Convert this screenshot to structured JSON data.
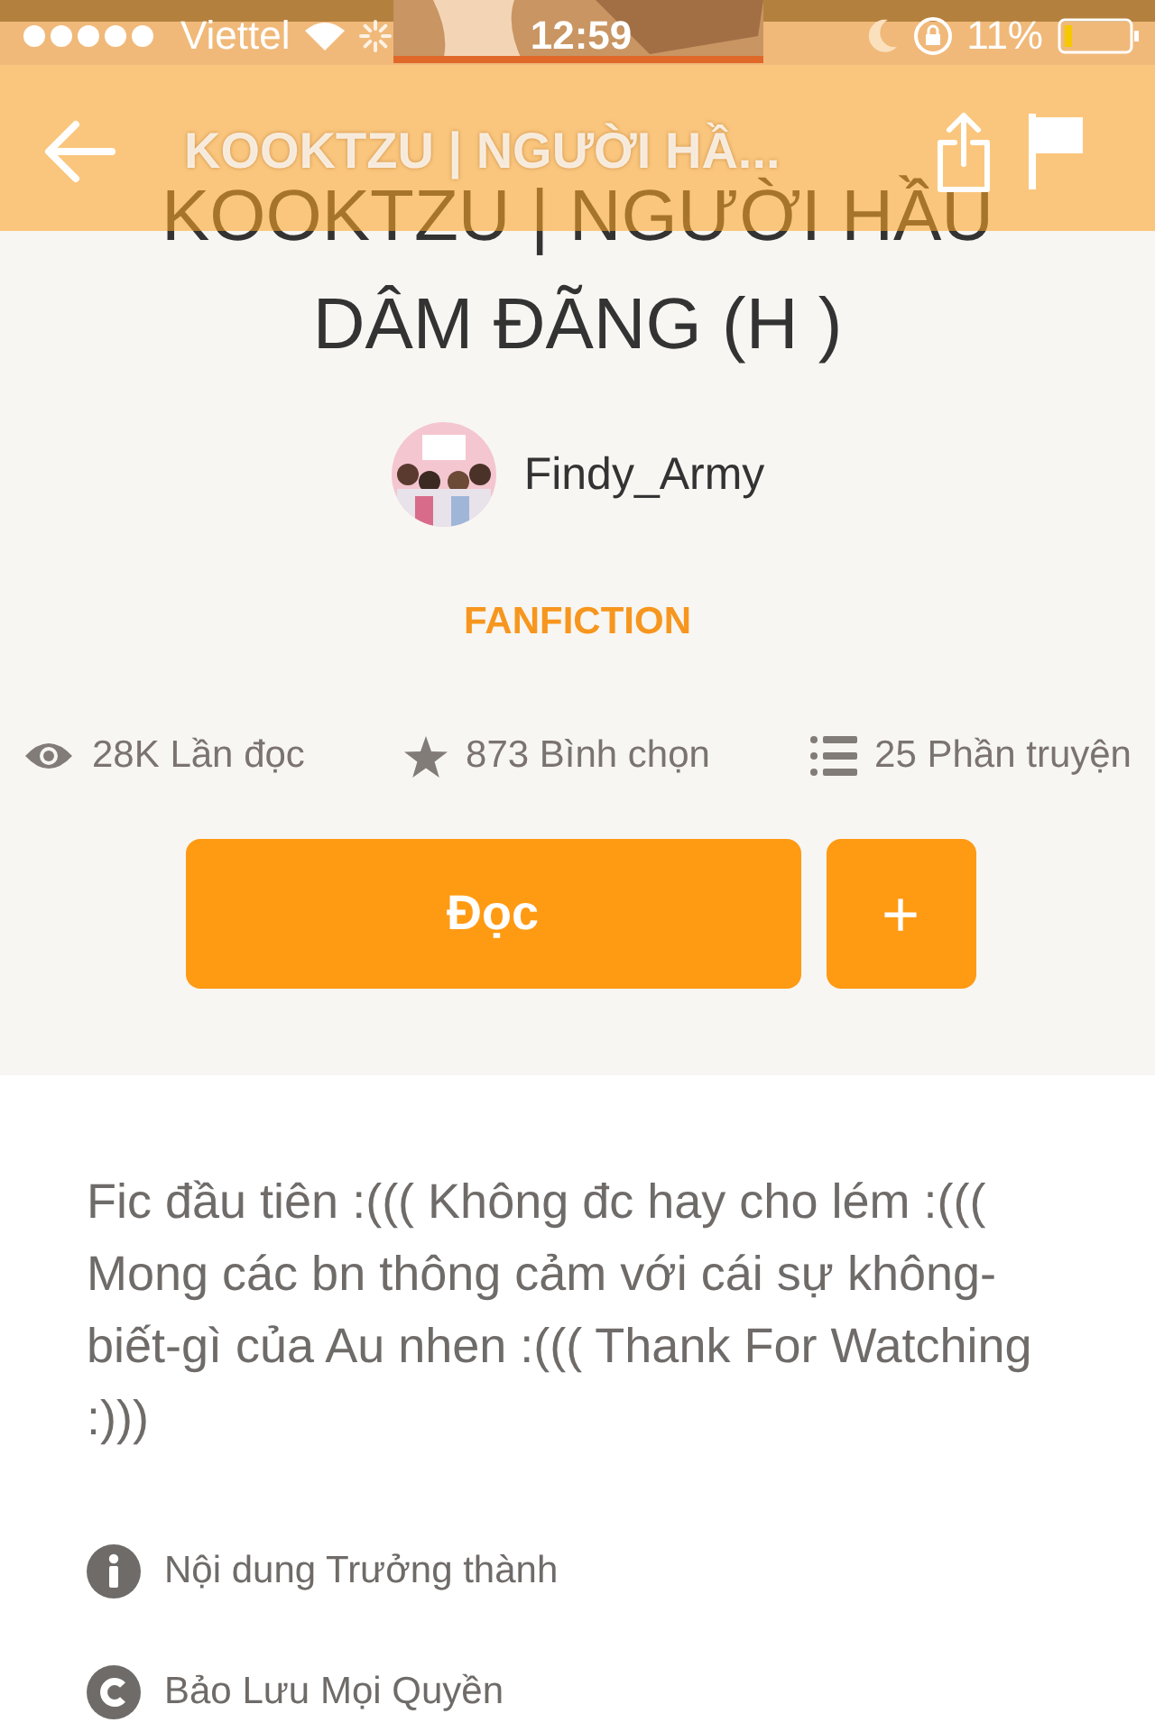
{
  "status_bar": {
    "carrier": "Viettel",
    "time": "12:59",
    "battery": "11%"
  },
  "nav": {
    "title": "KOOKTZU | NGƯỜI HẦ..."
  },
  "story": {
    "title": "KOOKTZU | NGƯỜI HẦU DÂM ĐÃNG (H )",
    "author": "Findy_Army",
    "category": "FANFICTION",
    "stats": [
      {
        "kind": "reads",
        "text": "28K Lần đọc"
      },
      {
        "kind": "votes",
        "text": "873 Bình chọn"
      },
      {
        "kind": "parts",
        "text": "25 Phần truyện"
      }
    ],
    "read_button": "Đọc",
    "add_button": "+"
  },
  "description": "Fic đầu tiên :((( Không đc hay cho lém :((( Mong các bn thông cảm với cái sự không-biết-gì của Au nhen :((( Thank For Watching :)))",
  "notes": [
    {
      "kind": "mature",
      "text": "Nội dung Trưởng thành"
    },
    {
      "kind": "copyright",
      "text": "Bảo Lưu Mọi Quyền"
    }
  ]
}
